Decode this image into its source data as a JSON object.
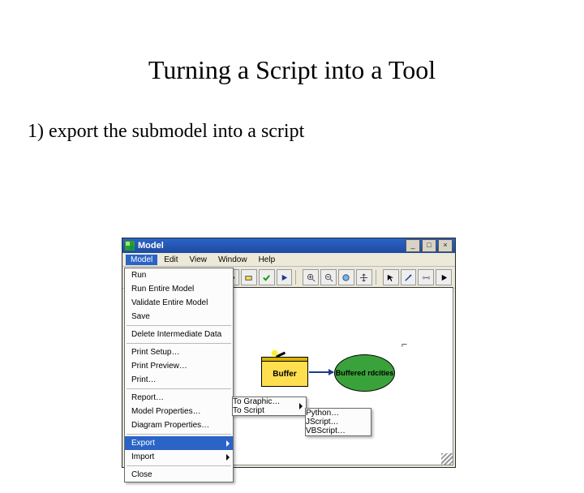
{
  "slide": {
    "title": "Turning a Script into a Tool",
    "bullet": "1)   export the submodel into a script"
  },
  "window": {
    "title": "Model",
    "min": "_",
    "max": "□",
    "close": "×"
  },
  "menubar": {
    "model": "Model",
    "edit": "Edit",
    "view": "View",
    "window": "Window",
    "help": "Help"
  },
  "menu_model": {
    "run": "Run",
    "run_entire": "Run Entire Model",
    "validate": "Validate Entire Model",
    "save": "Save",
    "delete_intermediate": "Delete Intermediate Data",
    "print_setup": "Print Setup…",
    "print_preview": "Print Preview…",
    "print": "Print…",
    "report": "Report…",
    "model_props": "Model Properties…",
    "diagram_props": "Diagram Properties…",
    "export": "Export",
    "import": "Import",
    "close": "Close"
  },
  "submenu_export": {
    "to_graphic": "To Graphic…",
    "to_script": "To Script"
  },
  "submenu_script": {
    "python": "Python…",
    "jscript": "JScript…",
    "vbscript": "VBScript…"
  },
  "diagram": {
    "buffer": "Buffer",
    "output": "Buffered rdcities"
  }
}
